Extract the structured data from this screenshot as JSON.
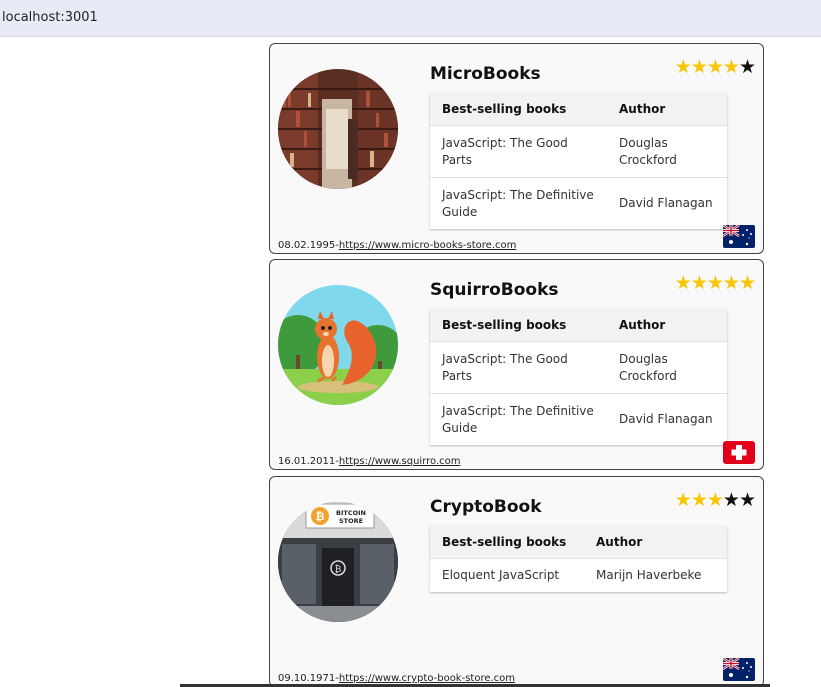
{
  "browser": {
    "url": "localhost:3001"
  },
  "stores": [
    {
      "name": "MicroBooks",
      "rating": 4,
      "rating_max": 5,
      "table_headers": [
        "Best-selling books",
        "Author"
      ],
      "books": [
        {
          "title": "JavaScript: The Good Parts",
          "author": "Douglas Crockford"
        },
        {
          "title": "JavaScript: The Definitive Guide",
          "author": "David Flanagan"
        }
      ],
      "date": "08.02.1995",
      "separator": "-",
      "website": "https://www.micro-books-store.com",
      "country_flag": "australia-flag",
      "image": "bookstore-shelves-image"
    },
    {
      "name": "SquirroBooks",
      "rating": 5,
      "rating_max": 5,
      "table_headers": [
        "Best-selling books",
        "Author"
      ],
      "books": [
        {
          "title": "JavaScript: The Good Parts",
          "author": "Douglas Crockford"
        },
        {
          "title": "JavaScript: The Definitive Guide",
          "author": "David Flanagan"
        }
      ],
      "date": "16.01.2011",
      "separator": "-",
      "website": "https://www.squirro.com",
      "country_flag": "switzerland-flag",
      "image": "cartoon-squirrel-image"
    },
    {
      "name": "CryptoBook",
      "rating": 3,
      "rating_max": 5,
      "table_headers": [
        "Best-selling books",
        "Author"
      ],
      "books": [
        {
          "title": "Eloquent JavaScript",
          "author": "Marijn Haverbeke"
        }
      ],
      "date": "09.10.1971",
      "separator": "-",
      "website": "https://www.crypto-book-store.com",
      "country_flag": "australia-flag",
      "image": "bitcoin-store-front-image",
      "image_sign_text": "BITCOIN STORE"
    }
  ],
  "colors": {
    "star_filled": "#f7c600",
    "star_empty": "#111111",
    "card_background": "#f9f9f9",
    "url_bar": "#e8ebf6"
  }
}
